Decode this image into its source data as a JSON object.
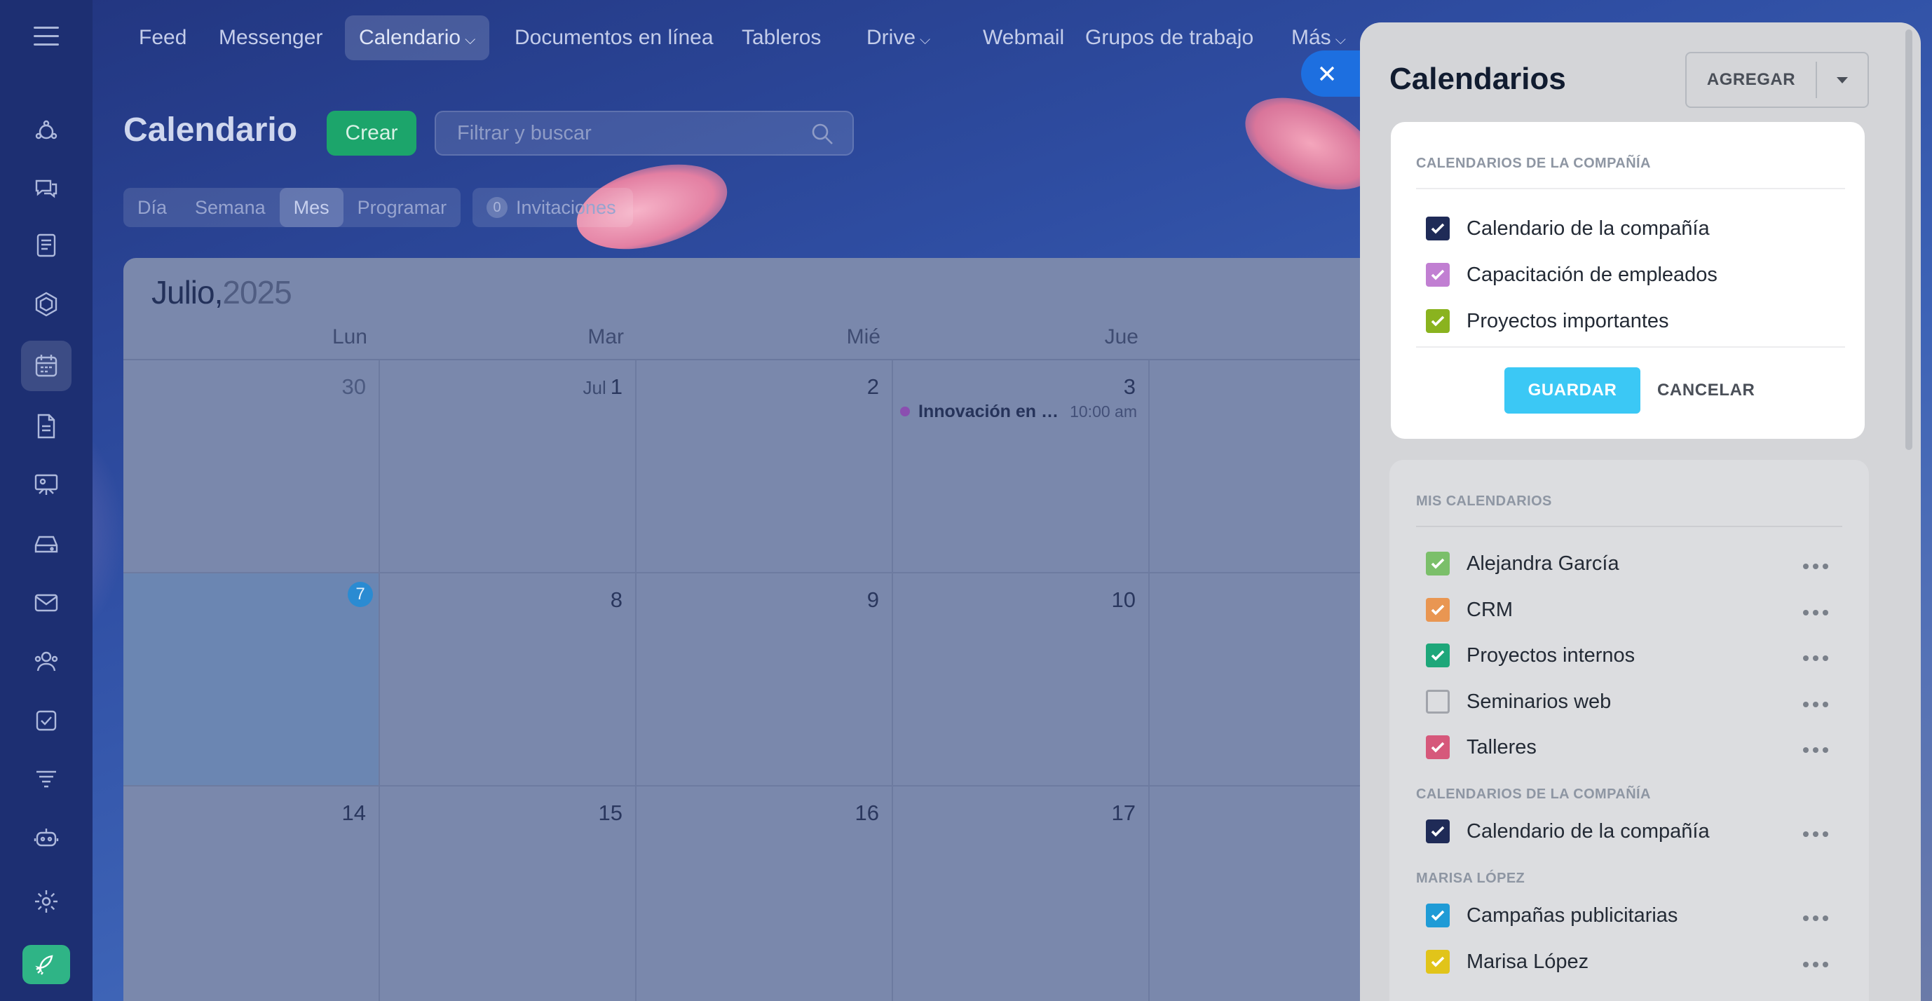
{
  "topnav": {
    "items": [
      {
        "label": "Feed",
        "chevron": false
      },
      {
        "label": "Messenger",
        "chevron": false
      },
      {
        "label": "Calendario",
        "chevron": true
      },
      {
        "label": "Documentos en línea",
        "chevron": false
      },
      {
        "label": "Tableros",
        "chevron": false
      },
      {
        "label": "Drive",
        "chevron": true
      },
      {
        "label": "Webmail",
        "chevron": false
      },
      {
        "label": "Grupos de trabajo",
        "chevron": false
      },
      {
        "label": "Más",
        "chevron": true
      }
    ],
    "active": "Calendario"
  },
  "sidebar_icons": [
    "hamburger-icon",
    "activity-stream-icon",
    "chat-icon",
    "feed-icon",
    "sites-icon",
    "calendar-icon",
    "document-icon",
    "presentation-icon",
    "drive-icon",
    "mail-icon",
    "groups-icon",
    "tasks-icon",
    "filter-icon",
    "robot-icon",
    "settings-icon",
    "rocket-icon"
  ],
  "page": {
    "title": "Calendario",
    "create_label": "Crear",
    "search_placeholder": "Filtrar y buscar",
    "view_tabs": [
      "Día",
      "Semana",
      "Mes",
      "Programar"
    ],
    "active_view": "Mes",
    "invitations": {
      "count": "0",
      "label": "Invitaciones"
    }
  },
  "calendar": {
    "month": "Julio,",
    "year": "2025",
    "weekdays": [
      "Lun",
      "Mar",
      "Mié",
      "Jue"
    ],
    "weeks": [
      [
        {
          "day": "30",
          "muted": true
        },
        {
          "day": "1",
          "prefix": "Jul"
        },
        {
          "day": "2"
        },
        {
          "day": "3"
        }
      ],
      [
        {
          "day": "7",
          "today": true
        },
        {
          "day": "8"
        },
        {
          "day": "9"
        },
        {
          "day": "10"
        }
      ],
      [
        {
          "day": "14"
        },
        {
          "day": "15"
        },
        {
          "day": "16"
        },
        {
          "day": "17"
        }
      ]
    ],
    "event": {
      "name": "Innovación en ac...",
      "time": "10:00 am",
      "color": "#8b4fb0"
    }
  },
  "panel": {
    "title": "Calendarios",
    "add_label": "AGREGAR",
    "popup": {
      "section": "CALENDARIOS DE LA COMPAÑÍA",
      "items": [
        {
          "label": "Calendario de la compañía",
          "color": "#1f2b57",
          "checked": true
        },
        {
          "label": "Capacitación de empleados",
          "color": "#c17fd2",
          "checked": true
        },
        {
          "label": "Proyectos importantes",
          "color": "#8ab31f",
          "checked": true
        }
      ],
      "save_label": "GUARDAR",
      "cancel_label": "CANCELAR"
    },
    "my_calendars": {
      "section": "MIS CALENDARIOS",
      "items": [
        {
          "label": "Alejandra García",
          "color": "#7bbf6a",
          "checked": true
        },
        {
          "label": "CRM",
          "color": "#e99652",
          "checked": true
        },
        {
          "label": "Proyectos internos",
          "color": "#1ea77a",
          "checked": true
        },
        {
          "label": "Seminarios web",
          "color": "",
          "checked": false
        },
        {
          "label": "Talleres",
          "color": "#d6587b",
          "checked": true
        }
      ]
    },
    "company_calendars": {
      "section": "CALENDARIOS DE LA COMPAÑÍA",
      "items": [
        {
          "label": "Calendario de la compañía",
          "color": "#1f2b57",
          "checked": true
        }
      ]
    },
    "shared_calendars": {
      "section": "MARISA LÓPEZ",
      "items": [
        {
          "label": "Campañas publicitarias",
          "color": "#1f9bd6",
          "checked": true
        },
        {
          "label": "Marisa López",
          "color": "#e1c41a",
          "checked": true
        }
      ]
    }
  }
}
